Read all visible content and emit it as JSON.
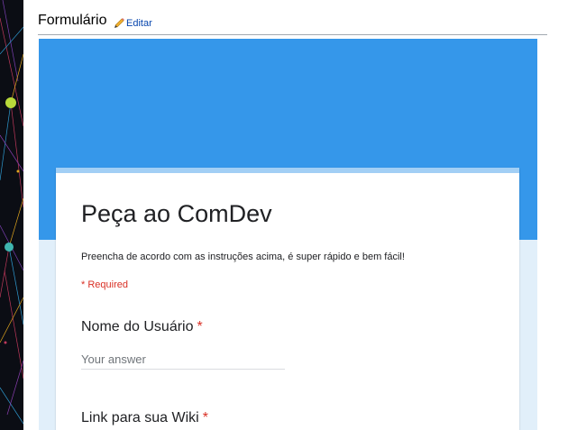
{
  "section": {
    "title": "Formulário",
    "edit_label": "Editar",
    "edit_icon": "pencil-icon"
  },
  "colors": {
    "banner": "#3597ea",
    "background": "#e1effa",
    "card_top_border": "#a2cff5",
    "required": "#d93025",
    "link": "#0645ad"
  },
  "form": {
    "title": "Peça ao ComDev",
    "description": "Preencha de acordo com as instruções acima, é super rápido e bem fácil!",
    "required_note": "* Required",
    "questions": [
      {
        "label": "Nome do Usuário",
        "required_marker": "*",
        "placeholder": "Your answer"
      },
      {
        "label": "Link para sua Wiki",
        "required_marker": "*"
      }
    ]
  }
}
